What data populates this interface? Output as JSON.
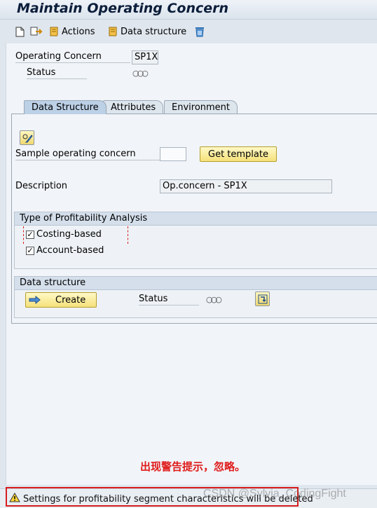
{
  "window": {
    "title": "Maintain Operating Concern"
  },
  "toolbar": {
    "actions_label": "Actions",
    "data_structure_label": "Data structure"
  },
  "header": {
    "operating_concern_label": "Operating Concern",
    "operating_concern_value": "SP1X",
    "status_label": "Status",
    "status_value": "○○○"
  },
  "tabs": [
    {
      "label": "Data Structure",
      "active": true
    },
    {
      "label": "Attributes",
      "active": false
    },
    {
      "label": "Environment",
      "active": false
    }
  ],
  "data_structure_tab": {
    "sample_label": "Sample operating concern",
    "sample_value": "",
    "get_template_label": "Get template",
    "description_label": "Description",
    "description_value": "Op.concern - SP1X",
    "profitability_group": {
      "title": "Type of Profitability Analysis",
      "costing_based_label": "Costing-based",
      "costing_based_checked": true,
      "account_based_label": "Account-based",
      "account_based_checked": true
    },
    "data_structure_group": {
      "title": "Data structure",
      "create_label": "Create",
      "status_label": "Status",
      "status_value": "○○○"
    }
  },
  "annotation": {
    "text": "出现警告提示，忽略。"
  },
  "status_bar": {
    "message": "Settings for profitability segment characteristics will be deleted"
  },
  "watermark": {
    "text": "CSDN @Sylvia_CodingFight"
  },
  "colors": {
    "accent_red": "#d81e1e",
    "button_yellow": "#f5e17a",
    "tab_active": "#bcd0e6"
  }
}
